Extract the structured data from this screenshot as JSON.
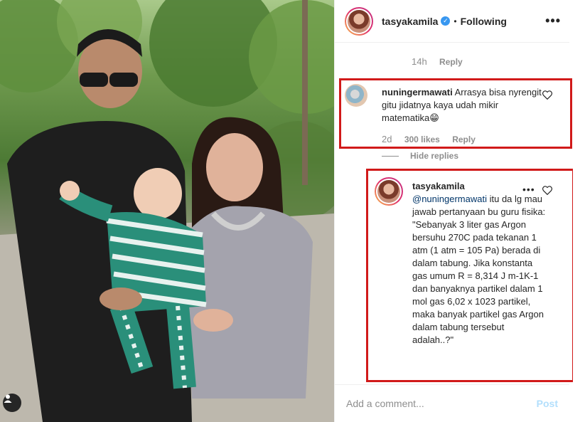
{
  "post": {
    "author": "tasyakamila",
    "separator": "•",
    "follow_status": "Following",
    "verified": true
  },
  "comments": {
    "previous_reply": {
      "time": "14h",
      "reply_label": "Reply"
    },
    "comment1": {
      "username": "nuningermawati",
      "text": " Arrasya bisa nyrengit gitu jidatnya kaya udah mikir matematika😁",
      "time": "2d",
      "likes": "300 likes",
      "reply_label": "Reply"
    },
    "hide_replies": "Hide replies",
    "reply1": {
      "username": "tasyakamila",
      "mention": "@nuningermawati",
      "text": " itu da lg mau jawab pertanyaan bu guru fisika: \"Sebanyak 3 liter gas Argon bersuhu 270C pada tekanan 1 atm (1 atm = 105 Pa) berada di dalam tabung. Jika konstanta gas umum R = 8,314 J m-1K-1 dan banyaknya partikel dalam 1 mol gas 6,02 x 1023 partikel, maka banyak partikel gas Argon dalam tabung tersebut adalah..?\""
    }
  },
  "comment_input": {
    "placeholder": "Add a comment..."
  },
  "post_label": "Post",
  "icons": {
    "more": "more-horizontal-icon",
    "heart": "heart-outline-icon",
    "verified": "verified-badge-icon",
    "user_tag": "user-tag-icon"
  },
  "colors": {
    "highlight_box": "#d11a1a",
    "verified": "#3897f0",
    "post_disabled": "#b2dffc",
    "mention": "#003569"
  }
}
